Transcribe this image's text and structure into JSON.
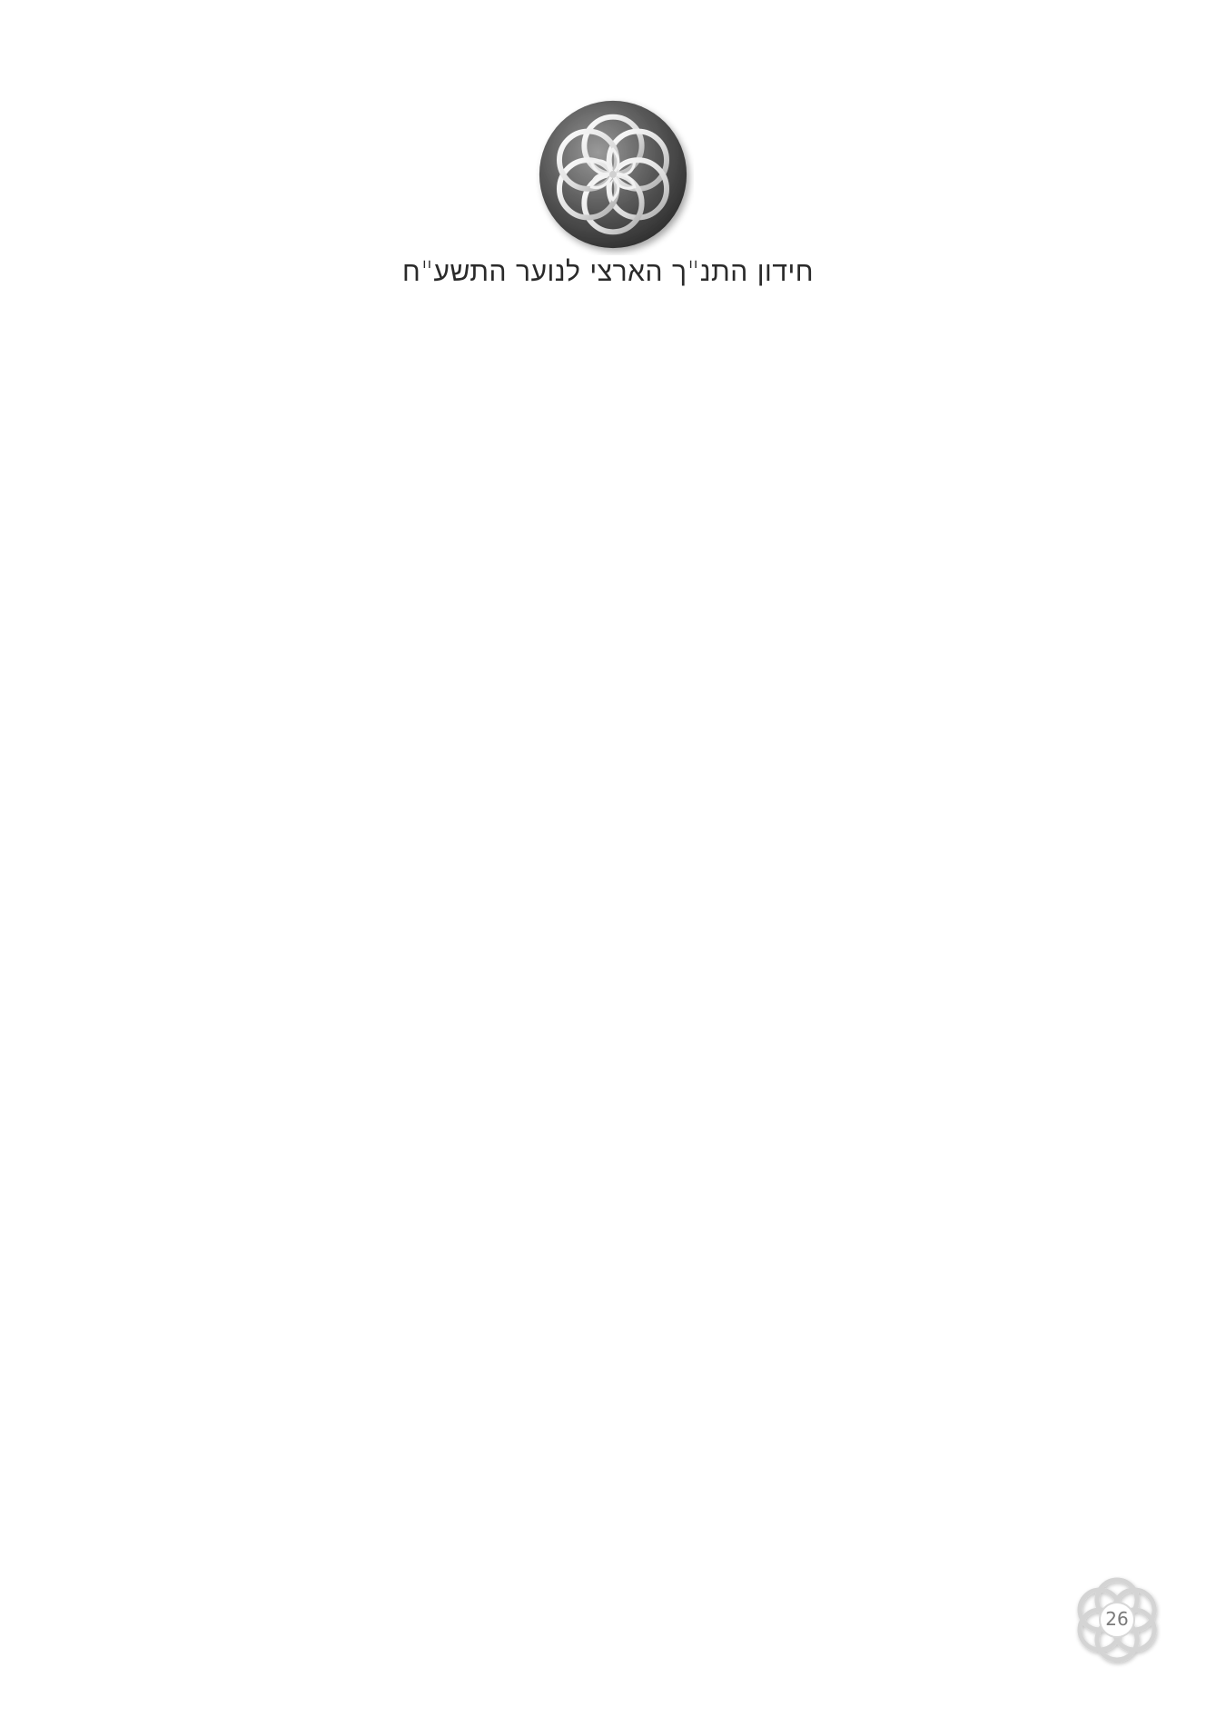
{
  "header": {
    "emblem_icon": "rosette-emblem-icon",
    "title": "חידון התנ\"ך הארצי לנוער התשע\"ח"
  },
  "footer": {
    "page_badge_icon": "rosette-badge-icon",
    "page_number": "26"
  },
  "colors": {
    "title_text": "#2a2a2a",
    "page_number_text": "#7a7a7a",
    "emblem_dark": "#4a4a4a",
    "emblem_light": "#e6e6e6",
    "badge_light": "#d8d8d8"
  }
}
